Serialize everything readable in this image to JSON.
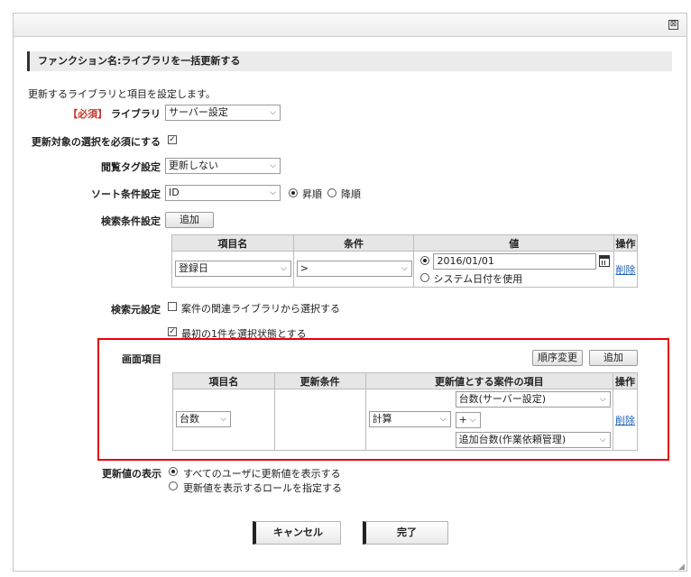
{
  "window": {
    "close_glyph": "⊠",
    "resize_glyph": "◢"
  },
  "header": {
    "title": "ファンクション名:ライブラリを一括更新する"
  },
  "intro": "更新するライブラリと項目を設定します。",
  "library": {
    "required_tag": "【必須】",
    "label": "ライブラリ",
    "value": "サーバー設定"
  },
  "require_target": {
    "label": "更新対象の選択を必須にする",
    "checked": true
  },
  "browse_tag": {
    "label": "閲覧タグ設定",
    "value": "更新しない"
  },
  "sort": {
    "label": "ソート条件設定",
    "value": "ID",
    "asc": "昇順",
    "desc": "降順",
    "selected": "asc"
  },
  "search": {
    "label": "検索条件設定",
    "add_button": "追加",
    "headers": [
      "項目名",
      "条件",
      "値",
      "操作"
    ],
    "row": {
      "field": "登録日",
      "condition": ">",
      "date_value": "2016/01/01",
      "system_date_label": "システム日付を使用",
      "delete": "削除"
    }
  },
  "source": {
    "label": "検索元設定",
    "related_library": "案件の関連ライブラリから選択する",
    "related_checked": false,
    "first_item": "最初の1件を選択状態とする",
    "first_checked": true
  },
  "screen_items": {
    "label": "画面項目",
    "reorder_button": "順序変更",
    "add_button": "追加",
    "headers": [
      "項目名",
      "更新条件",
      "更新値とする案件の項目",
      "操作"
    ],
    "row": {
      "field": "台数",
      "update_condition": "",
      "calc": "計算",
      "value1": "台数(サーバー設定)",
      "operator": "+",
      "value2": "追加台数(作業依頼管理)",
      "delete": "削除"
    }
  },
  "display": {
    "label": "更新値の表示",
    "option_all": "すべてのユーザに更新値を表示する",
    "option_role": "更新値を表示するロールを指定する",
    "selected": "all"
  },
  "footer": {
    "cancel": "キャンセル",
    "done": "完了"
  },
  "colors": {
    "highlight_frame": "#e60012",
    "link": "#1a5fb4",
    "required": "#c0392b"
  }
}
